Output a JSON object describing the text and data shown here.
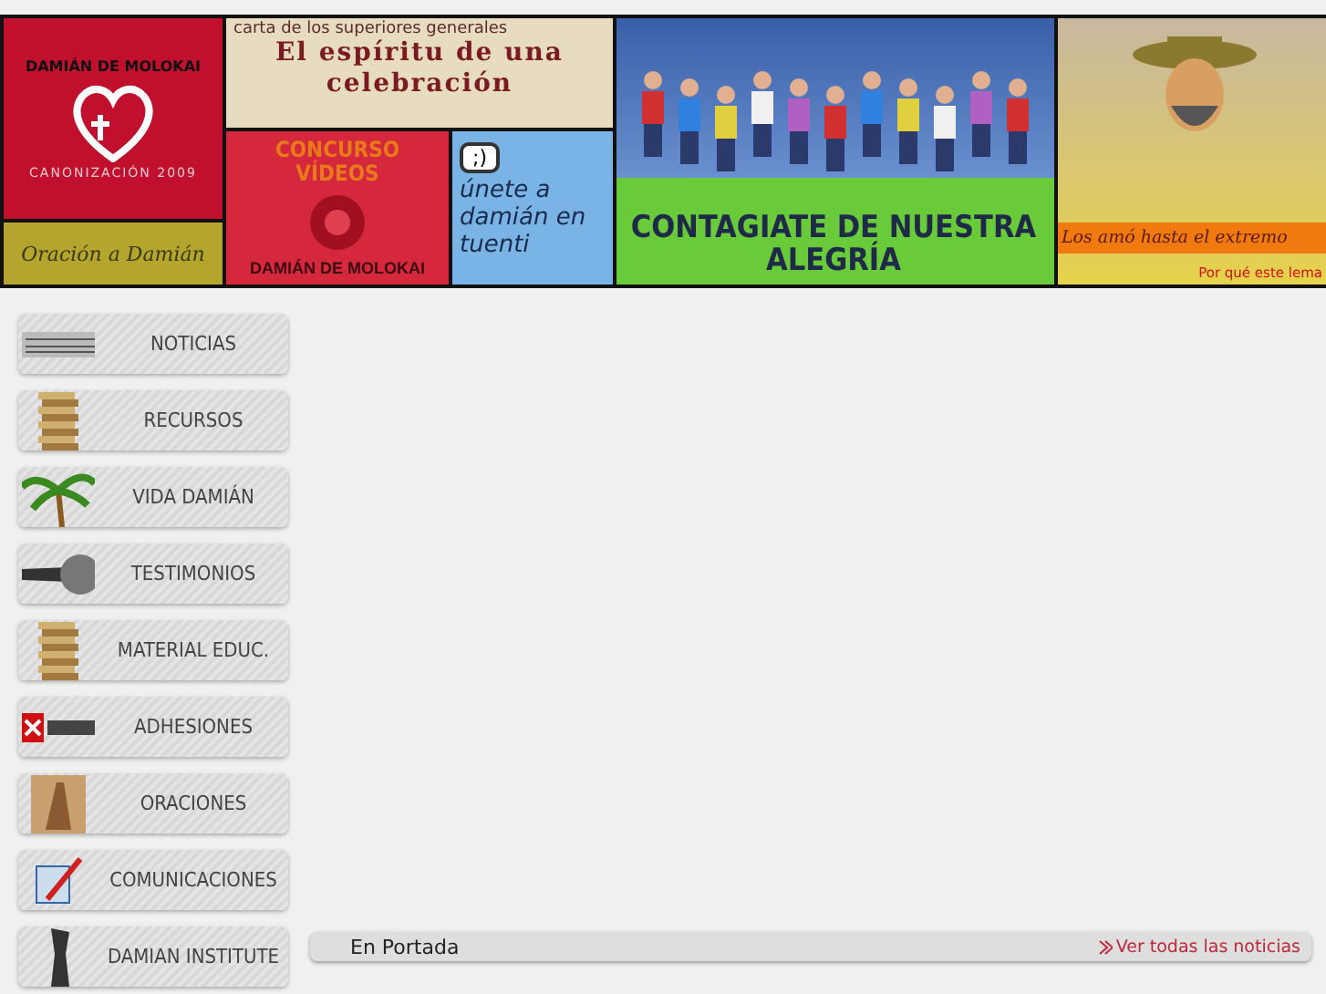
{
  "banner": {
    "logo": {
      "arc_text": "DAMIÁN DE MOLOKAI",
      "subtitle": "CANONIZACIÓN 2009"
    },
    "prayer": "Oración a Damián",
    "letter": {
      "caption": "carta de los superiores generales",
      "title": "El espíritu de una celebración"
    },
    "contest": {
      "title": "CONCURSO VÍDEOS",
      "footer": "DAMIÁN DE MOLOKAI"
    },
    "tuenti": {
      "badge": ";)",
      "text": "únete a damián en tuenti"
    },
    "joy": {
      "headline": "CONTAGIATE DE NUESTRA ALEGRÍA"
    },
    "motto": {
      "text": "Los amó hasta el extremo",
      "link": "Por qué este lema"
    }
  },
  "nav": [
    {
      "label": "NOTICIAS",
      "kind": "news"
    },
    {
      "label": "RECURSOS",
      "kind": "stack"
    },
    {
      "label": "VIDA DAMIÁN",
      "kind": "palm"
    },
    {
      "label": "TESTIMONIOS",
      "kind": "mic"
    },
    {
      "label": "MATERIAL EDUC.",
      "kind": "stack"
    },
    {
      "label": "ADHESIONES",
      "kind": "flag"
    },
    {
      "label": "ORACIONES",
      "kind": "hands"
    },
    {
      "label": "COMUNICACIONES",
      "kind": "pen"
    },
    {
      "label": "DAMIAN INSTITUTE",
      "kind": "statue"
    }
  ],
  "section": {
    "title": "En Portada",
    "link": "Ver todas las noticias"
  }
}
